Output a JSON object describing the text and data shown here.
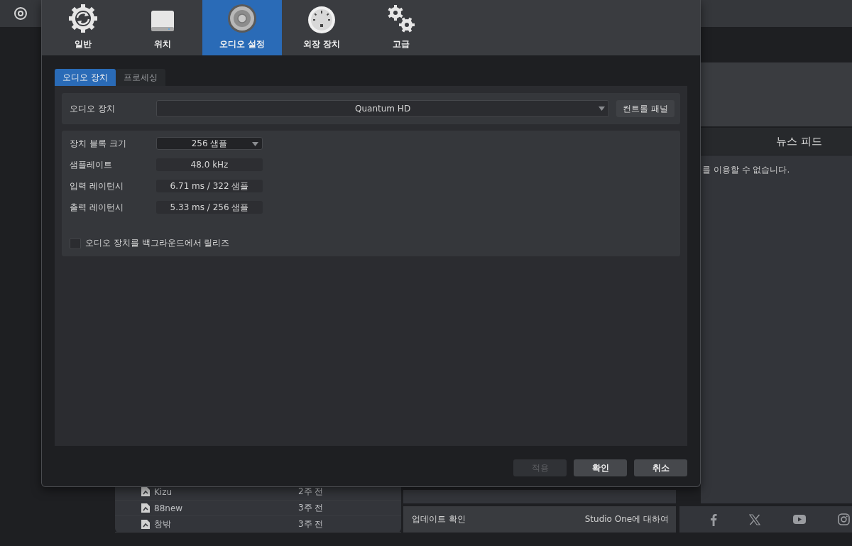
{
  "app": {
    "news_feed": {
      "title": "뉴스 피드",
      "message": "를 이용할 수 없습니다."
    },
    "recent_files": [
      {
        "name": "Kizu",
        "time": "2주 전"
      },
      {
        "name": "88new",
        "time": "3주 전"
      },
      {
        "name": "창밖",
        "time": "3주 전"
      }
    ],
    "footer_links": [
      "업데이트 확인",
      "Studio One에 대하여"
    ],
    "social": [
      {
        "kind": "facebook"
      },
      {
        "kind": "x"
      },
      {
        "kind": "youtube"
      },
      {
        "kind": "instagram"
      }
    ]
  },
  "dialog": {
    "tabs": [
      {
        "label": "일반",
        "kind": "general",
        "selected": false
      },
      {
        "label": "위치",
        "kind": "location",
        "selected": false
      },
      {
        "label": "오디오 설정",
        "kind": "audio",
        "selected": true
      },
      {
        "label": "외장 장치",
        "kind": "external",
        "selected": false
      },
      {
        "label": "고급",
        "kind": "advanced",
        "selected": false
      }
    ],
    "subtabs": [
      {
        "label": "오디오 장치",
        "selected": true
      },
      {
        "label": "프로세싱",
        "selected": false
      }
    ],
    "audio_device": {
      "label": "오디오 장치",
      "value": "Quantum HD",
      "button": "컨트롤 패널"
    },
    "settings": [
      {
        "label": "장치 블록 크기",
        "value": "256 샘플",
        "kind": "dropdown"
      },
      {
        "label": "샘플레이트",
        "value": "48.0 kHz",
        "kind": "readout"
      },
      {
        "label": "입력 레이턴시",
        "value": "6.71 ms / 322 샘플",
        "kind": "readout"
      },
      {
        "label": "출력 레이턴시",
        "value": "5.33 ms / 256 샘플",
        "kind": "readout"
      }
    ],
    "release_checkbox": {
      "label": "오디오 장치를 백그라운드에서 릴리즈",
      "checked": false
    },
    "buttons": [
      {
        "label": "적용",
        "disabled": true
      },
      {
        "label": "확인",
        "disabled": false
      },
      {
        "label": "취소",
        "disabled": false
      }
    ]
  }
}
